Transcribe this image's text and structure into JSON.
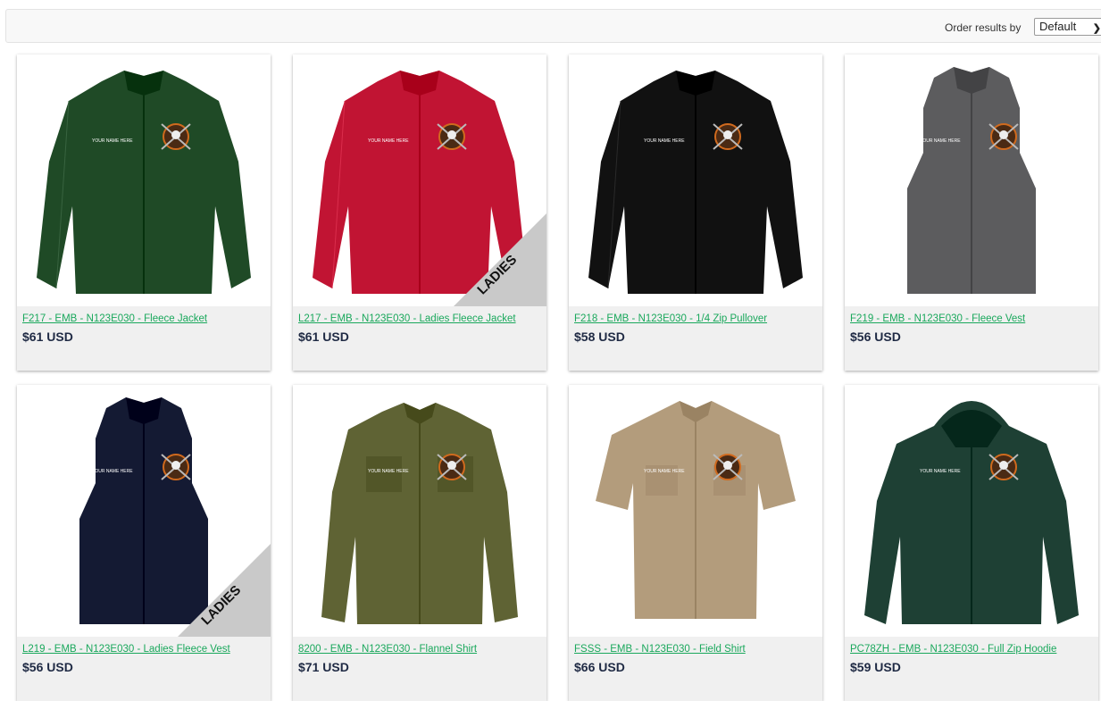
{
  "toolbar": {
    "order_label": "Order results by",
    "order_value": "Default"
  },
  "products": [
    {
      "title": "F217 - EMB - N123E030 - Fleece Jacket",
      "price": "$61 USD",
      "color": "#1f4a26",
      "ladies": false,
      "garment": "jacket",
      "embroidery": "YOUR NAME HERE"
    },
    {
      "title": "L217 - EMB - N123E030 - Ladies Fleece Jacket",
      "price": "$61 USD",
      "color": "#c11433",
      "ladies": true,
      "garment": "jacket",
      "embroidery": "YOUR NAME HERE"
    },
    {
      "title": "F218 - EMB - N123E030 - 1/4 Zip Pullover",
      "price": "$58 USD",
      "color": "#111111",
      "ladies": false,
      "garment": "jacket",
      "embroidery": "YOUR NAME HERE"
    },
    {
      "title": "F219 - EMB - N123E030 - Fleece Vest",
      "price": "$56 USD",
      "color": "#5c5c5e",
      "ladies": false,
      "garment": "vest",
      "embroidery": "YOUR NAME HERE"
    },
    {
      "title": "L219 - EMB - N123E030 - Ladies Fleece Vest",
      "price": "$56 USD",
      "color": "#141a33",
      "ladies": true,
      "garment": "vest",
      "embroidery": "YOUR NAME HERE"
    },
    {
      "title": "8200 - EMB - N123E030 - Flannel Shirt",
      "price": "$71 USD",
      "color": "#5f6334",
      "ladies": false,
      "garment": "shirt",
      "embroidery": "YOUR NAME HERE"
    },
    {
      "title": "FSSS - EMB - N123E030 - Field Shirt",
      "price": "$66 USD",
      "color": "#b39c7c",
      "ladies": false,
      "garment": "shortshirt",
      "embroidery": "YOUR NAME HERE"
    },
    {
      "title": "PC78ZH - EMB - N123E030 - Full Zip Hoodie",
      "price": "$59 USD",
      "color": "#1e4034",
      "ladies": false,
      "garment": "hoodie",
      "embroidery": "YOUR NAME HERE"
    }
  ],
  "badge_text": "LADIES",
  "colors": {
    "link": "#1aa85c",
    "price": "#1f2a44"
  }
}
